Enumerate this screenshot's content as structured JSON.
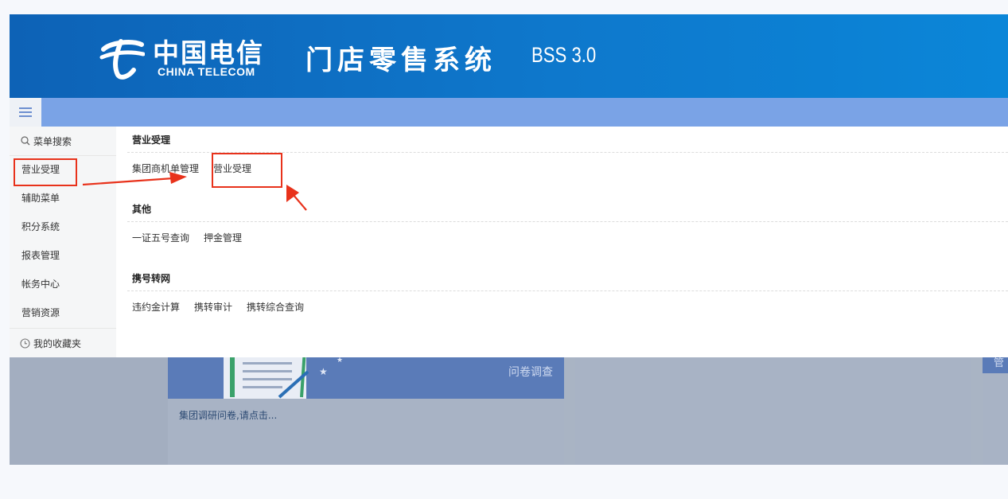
{
  "header": {
    "logo_cn": "中国电信",
    "logo_en": "CHINA TELECOM",
    "system_title": "门店零售系统",
    "version": "BSS 3.0"
  },
  "navbar": {
    "menu_icon": "hamburger-icon"
  },
  "sidebar": {
    "search_label": "菜单搜索",
    "items": [
      {
        "label": "营业受理"
      },
      {
        "label": "辅助菜单"
      },
      {
        "label": "积分系统"
      },
      {
        "label": "报表管理"
      },
      {
        "label": "帐务中心"
      },
      {
        "label": "营销资源"
      }
    ],
    "favorites_label": "我的收藏夹"
  },
  "menu_sections": [
    {
      "title": "营业受理",
      "links": [
        "集团商机单管理",
        "营业受理"
      ]
    },
    {
      "title": "其他",
      "links": [
        "一证五号查询",
        "押金管理"
      ]
    },
    {
      "title": "携号转网",
      "links": [
        "违约金计算",
        "携转审计",
        "携转综合查询"
      ]
    }
  ],
  "background": {
    "survey_label": "问卷调查",
    "survey_text": "集团调研问卷,请点击...",
    "card3_label": "管"
  },
  "colors": {
    "banner": "#0e78cc",
    "navbar": "#7aa3e6",
    "annotation": "#e8321b"
  }
}
